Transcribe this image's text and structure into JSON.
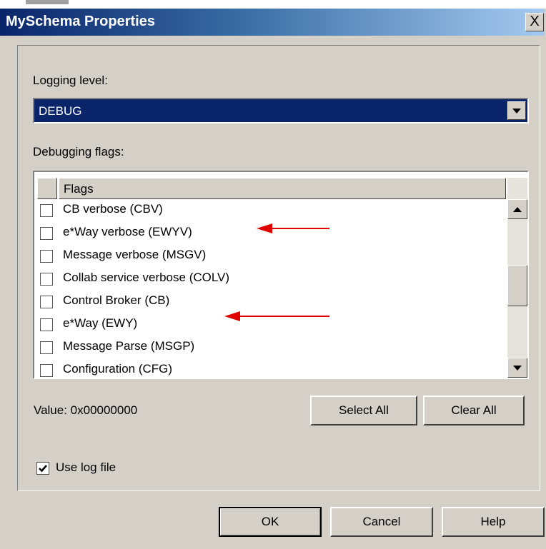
{
  "window": {
    "title": "MySchema Properties",
    "close_label": "X"
  },
  "logging": {
    "label": "Logging level:",
    "selected": "DEBUG"
  },
  "debugging": {
    "label": "Debugging flags:",
    "column_header": "Flags",
    "flags": [
      {
        "label": "CB verbose (CBV)",
        "checked": false
      },
      {
        "label": "e*Way verbose (EWYV)",
        "checked": false
      },
      {
        "label": "Message verbose (MSGV)",
        "checked": false
      },
      {
        "label": "Collab service verbose (COLV)",
        "checked": false
      },
      {
        "label": "Control Broker (CB)",
        "checked": false
      },
      {
        "label": "e*Way (EWY)",
        "checked": false
      },
      {
        "label": "Message Parse (MSGP)",
        "checked": false
      },
      {
        "label": "Configuration (CFG)",
        "checked": false
      }
    ]
  },
  "value_text": "Value: 0x00000000",
  "buttons": {
    "select_all": "Select All",
    "clear_all": "Clear All",
    "ok": "OK",
    "cancel": "Cancel",
    "help": "Help"
  },
  "use_log_file": {
    "label": "Use log file",
    "checked": true
  },
  "annotation": {
    "arrow_color": "#e00000"
  }
}
